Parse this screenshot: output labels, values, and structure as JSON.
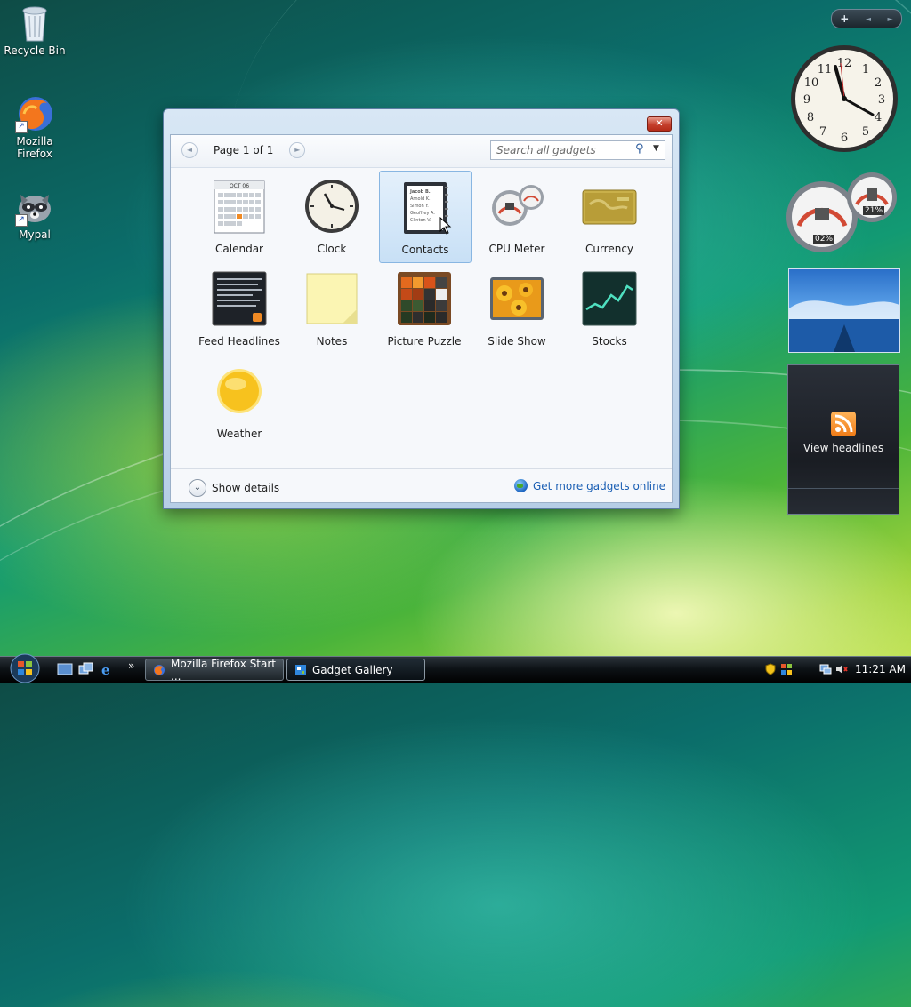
{
  "desktop": {
    "icons": [
      {
        "label": "Recycle Bin"
      },
      {
        "label": "Mozilla Firefox"
      },
      {
        "label": "Mypal"
      }
    ]
  },
  "sidebar_controls": {
    "add": "+",
    "prev": "◄",
    "next": "►"
  },
  "gallery": {
    "close_label": "✕",
    "pager_text": "Page 1 of 1",
    "search_placeholder": "Search all gadgets",
    "gadgets": [
      {
        "label": "Calendar",
        "selected": false
      },
      {
        "label": "Clock",
        "selected": false
      },
      {
        "label": "Contacts",
        "selected": true
      },
      {
        "label": "CPU Meter",
        "selected": false
      },
      {
        "label": "Currency",
        "selected": false
      },
      {
        "label": "Feed Headlines",
        "selected": false
      },
      {
        "label": "Notes",
        "selected": false
      },
      {
        "label": "Picture Puzzle",
        "selected": false
      },
      {
        "label": "Slide Show",
        "selected": false
      },
      {
        "label": "Stocks",
        "selected": false
      },
      {
        "label": "Weather",
        "selected": false
      }
    ],
    "calendar_month": "OCT 06",
    "contacts_entries": [
      "Jacob B.",
      "Arnold K.",
      "Simon Y.",
      "Geoffrey A.",
      "Clinton V."
    ],
    "show_details": "Show details",
    "more_link": "Get more gadgets online"
  },
  "sidebar": {
    "cpu_value": "02%",
    "mem_value": "21%",
    "feed_label": "View headlines"
  },
  "taskbar": {
    "tasks": [
      {
        "label": "Mozilla Firefox Start ..."
      },
      {
        "label": "Gadget Gallery"
      }
    ],
    "quicklaunch_more": "»",
    "time": "11:21 AM"
  },
  "colors": {
    "accent": "#1b5fb4",
    "selection": "#c8e0f6",
    "close": "#c4402d"
  }
}
